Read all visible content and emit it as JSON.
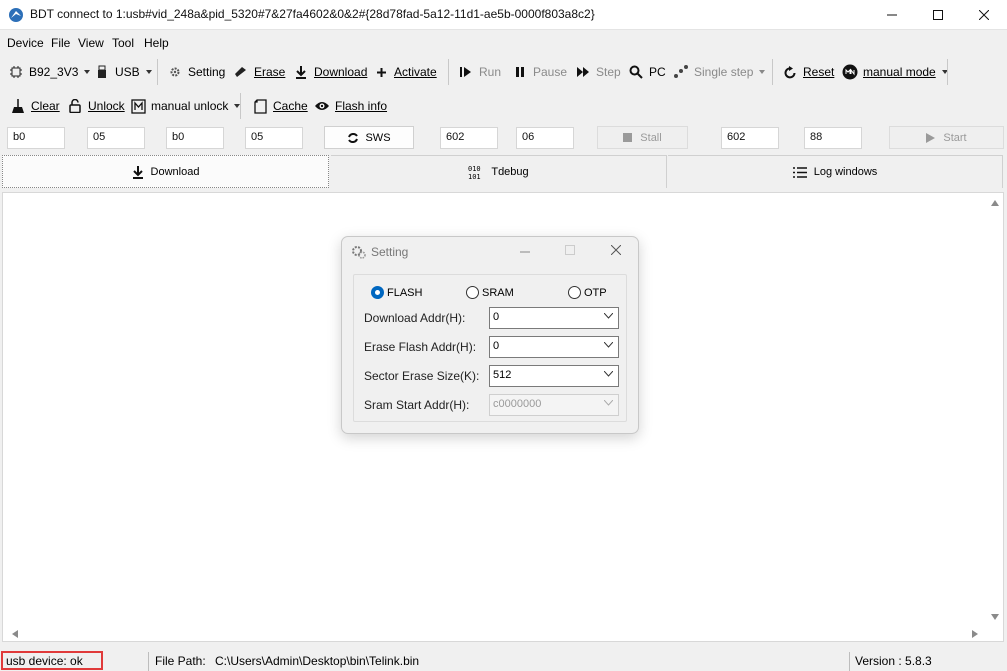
{
  "window": {
    "title": "BDT connect to 1:usb#vid_248a&pid_5320#7&27fa4602&0&2#{28d78fad-5a12-11d1-ae5b-0000f803a8c2}"
  },
  "menu": [
    "Device",
    "File",
    "View",
    "Tool",
    "Help"
  ],
  "toolbar1": {
    "chip": "B92_3V3",
    "usb": "USB",
    "setting": "Setting",
    "erase": "Erase",
    "download": "Download",
    "activate": "Activate",
    "run": "Run",
    "pause": "Pause",
    "step": "Step",
    "pc": "PC",
    "single_step": "Single step",
    "reset": "Reset",
    "manual_mode": "manual mode"
  },
  "toolbar2": {
    "clear": "Clear",
    "unlock": "Unlock",
    "manual_unlock": "manual unlock",
    "cache": "Cache",
    "flash_info": "Flash info"
  },
  "toolbar3": {
    "field1": "b0",
    "field2": "05",
    "field3": "b0",
    "field4": "05",
    "sws": "SWS",
    "field5": "602",
    "field6": "06",
    "stall": "Stall",
    "field7": "602",
    "field8": "88",
    "start": "Start"
  },
  "tabs": [
    "Download",
    "Tdebug",
    "Log windows"
  ],
  "dialog": {
    "title": "Setting",
    "radios": {
      "flash": "FLASH",
      "sram": "SRAM",
      "otp": "OTP"
    },
    "selected": "FLASH",
    "fields": [
      {
        "label": "Download  Addr(H):",
        "value": "0"
      },
      {
        "label": "Erase Flash Addr(H):",
        "value": "0"
      },
      {
        "label": "Sector Erase Size(K):",
        "value": "512"
      },
      {
        "label": "Sram Start Addr(H):",
        "value": "c0000000"
      }
    ]
  },
  "status": {
    "device": "usb device: ok",
    "file_path_label": "File Path:",
    "file_path": "C:\\Users\\Admin\\Desktop\\bin\\Telink.bin",
    "version": "Version : 5.8.3"
  },
  "colors": {
    "accent": "#0067c0",
    "highlight": "#e03a3a"
  }
}
